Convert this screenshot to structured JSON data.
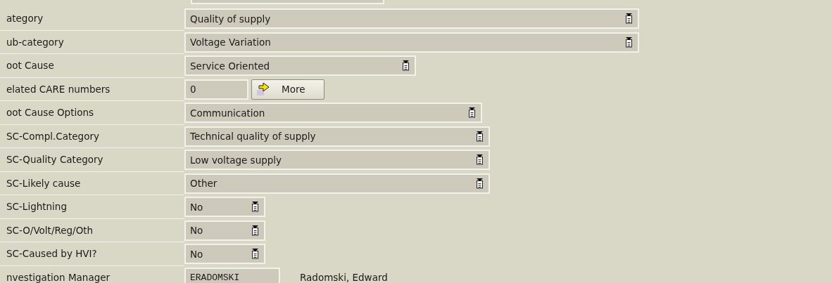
{
  "rows": [
    {
      "label": "ategory",
      "kind": "dropdown",
      "value": "Quality of supply"
    },
    {
      "label": "ub-category",
      "kind": "dropdown",
      "value": "Voltage Variation"
    },
    {
      "label": "oot Cause",
      "kind": "dropdown",
      "value": "Service Oriented"
    },
    {
      "label": "elated CARE numbers",
      "kind": "input_button",
      "value": "0",
      "button": "More"
    },
    {
      "label": "oot Cause Options",
      "kind": "dropdown",
      "value": "Communication"
    },
    {
      "label": "SC-Compl.Category",
      "kind": "dropdown",
      "value": "Technical quality of supply"
    },
    {
      "label": "SC-Quality Category",
      "kind": "dropdown",
      "value": "Low voltage supply"
    },
    {
      "label": "SC-Likely cause",
      "kind": "dropdown",
      "value": "Other"
    },
    {
      "label": "SC-Lightning",
      "kind": "dropdown",
      "value": "No"
    },
    {
      "label": "SC-O/Volt/Reg/Oth",
      "kind": "dropdown",
      "value": "No"
    },
    {
      "label": "SC-Caused by HVI?",
      "kind": "dropdown",
      "value": "No"
    },
    {
      "label": "nvestigation Manager",
      "kind": "input_text",
      "value": "ERADOMSKI",
      "text": "Radomski, Edward"
    }
  ]
}
